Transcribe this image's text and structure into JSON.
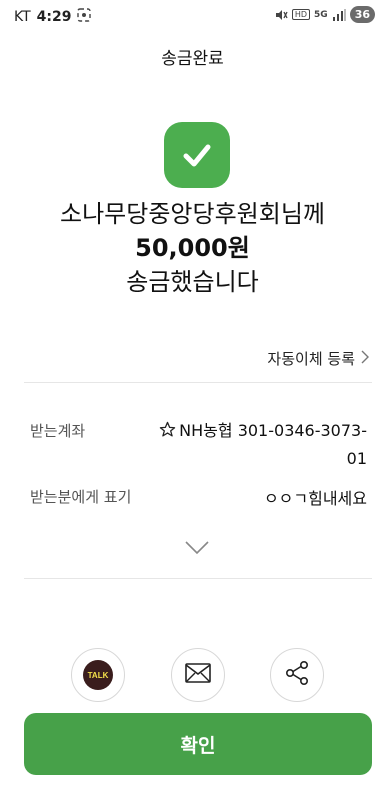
{
  "status_bar": {
    "carrier": "KT",
    "time": "4:29",
    "network": "5G",
    "hd": "HD",
    "battery": "36"
  },
  "header": {
    "title": "송금완료"
  },
  "result": {
    "line1": "소나무당중앙당후원회님께",
    "amount": "50,000원",
    "line3": "송금했습니다"
  },
  "auto_transfer": {
    "label": "자동이체 등록"
  },
  "details": {
    "account_label": "받는계좌",
    "account_value": "NH농협 301-0346-3073-01",
    "note_label": "받는분에게 표기",
    "note_value": "ㅇㅇㄱ힘내세요"
  },
  "share": {
    "kakao_label": "TALK"
  },
  "footer": {
    "confirm_label": "확인"
  },
  "colors": {
    "accent": "#47a149",
    "check_bg": "#4cae4f"
  }
}
